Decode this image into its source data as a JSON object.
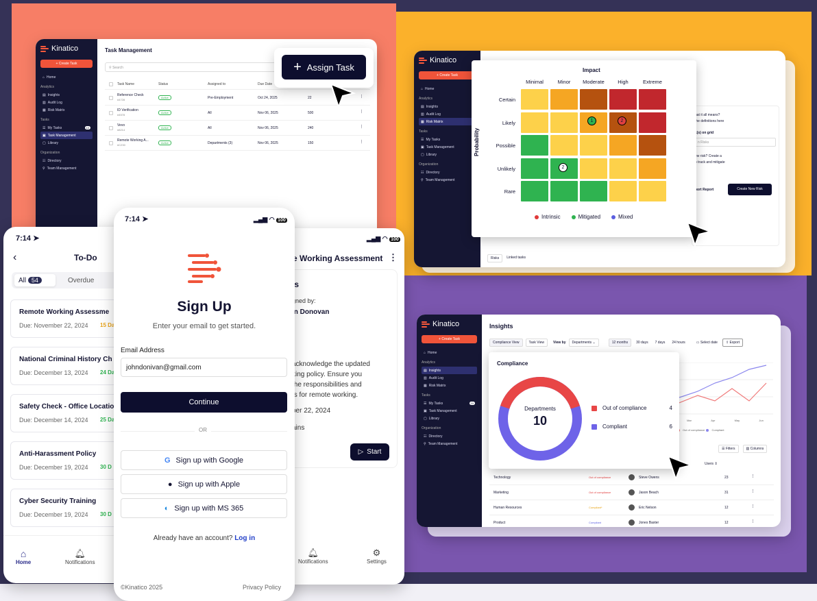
{
  "colors": {
    "coral": "#f77e66",
    "yellow": "#fbb12b",
    "purple": "#7a56ae",
    "navy": "#151633",
    "accent": "#f0543a"
  },
  "brand": "Kinatico",
  "common_nav": {
    "create": "+ Create Task",
    "home": "Home",
    "analytics": "Analytics",
    "insights": "Insights",
    "audit": "Audit Log",
    "risk": "Risk Matrix",
    "tasks": "Tasks",
    "my_tasks": "My Tasks",
    "my_tasks_count": "10",
    "task_mgmt": "Task Management",
    "library": "Library",
    "org": "Organization",
    "directory": "Directory",
    "team": "Team Management"
  },
  "task_panel": {
    "title": "Task Management",
    "search": "Search",
    "assign_btn": "Assign Task",
    "columns": [
      "Task Name",
      "Status",
      "Assigned to",
      "Due Date"
    ],
    "rows": [
      {
        "name": "Reference Check",
        "id": "#4728",
        "status": "Active",
        "assigned": "Pre-Employment",
        "due": "Oct 24, 2025",
        "n": "22"
      },
      {
        "name": "ID Verification",
        "id": "#4578",
        "status": "Active",
        "assigned": "All",
        "due": "Nov 06, 2025",
        "n": "500"
      },
      {
        "name": "Vevo",
        "id": "#8214",
        "status": "Active",
        "assigned": "All",
        "due": "Nov 06, 2025",
        "n": "240"
      },
      {
        "name": "Remote Working A...",
        "id": "#C230",
        "status": "Active",
        "assigned": "Departments (3)",
        "due": "Nov 06, 2025",
        "n": "150"
      }
    ]
  },
  "risk_panel": {
    "impact": "Impact",
    "probability": "Probability",
    "cols": [
      "Minimal",
      "Minor",
      "Moderate",
      "High",
      "Extreme"
    ],
    "rows": [
      "Certain",
      "Likely",
      "Possible",
      "Unlikely",
      "Rare"
    ],
    "legend": [
      {
        "label": "Intrinsic",
        "color": "#e03a3a"
      },
      {
        "label": "Mitigated",
        "color": "#2fb350"
      },
      {
        "label": "Mixed",
        "color": "#5b5fe0"
      }
    ],
    "marker1": "1",
    "marker2": "2",
    "marker3": "2",
    "side_q1": "hat it all means?",
    "side_q2": "the definitions here",
    "side_label": "k(s) on grid",
    "side_select": "n Risks",
    "side_q3": "ew risk? Create a",
    "side_q4": "o track and mitigate",
    "export_report": "port Report",
    "create_risk": "Create New Risk",
    "tab1": "Risks",
    "tab2": "Linked tasks"
  },
  "insights_panel": {
    "title": "Insights",
    "views": [
      "Compliance View",
      "Task View"
    ],
    "view_by": "View by",
    "view_by_val": "Departments",
    "ranges": [
      "12 months",
      "30 days",
      "7 days",
      "24 hours"
    ],
    "select_date": "Select date",
    "export": "Export",
    "compliance": "Compliance",
    "donut_label": "Departments",
    "donut_value": "10",
    "legend": [
      {
        "label": "Out of compliance",
        "value": "4",
        "color": "#e84646"
      },
      {
        "label": "Compliant",
        "value": "6",
        "color": "#6e63e8"
      }
    ],
    "chart_months": [
      "Mar",
      "Apr",
      "May",
      "Jun"
    ],
    "chart_legend": [
      "Out of compliance",
      "Compliant"
    ],
    "filters": "Filters",
    "columns": "Columns",
    "users_col": "Users",
    "rows": [
      {
        "dept": "Technology",
        "status": "Out of compliance",
        "user": "Steve Owens",
        "n": "23"
      },
      {
        "dept": "Marketing",
        "status": "Out of compliance",
        "user": "Jason Beach",
        "n": "31"
      },
      {
        "dept": "Human Resources",
        "status": "Compliant*",
        "user": "Eric Nelson",
        "n": "12"
      },
      {
        "dept": "Product",
        "status": "Compliant",
        "user": "Jones Baxter",
        "n": "12"
      }
    ]
  },
  "phone_todo": {
    "time": "7:14",
    "title": "To-Do",
    "tab_all": "All",
    "tab_all_count": "54",
    "tab_overdue": "Overdue",
    "tab_u": "U",
    "items": [
      {
        "title": "Remote Working Assessme",
        "due": "Due: November 22, 2024",
        "badge": "15 Da",
        "bcolor": "#e8a317"
      },
      {
        "title": "National Criminal History Ch",
        "due": "Due: December 13, 2024",
        "badge": "24 Da",
        "bcolor": "#2fb350"
      },
      {
        "title": "Safety Check - Office Locatio",
        "due": "Due: December 14, 2024",
        "badge": "25 Da",
        "bcolor": "#2fb350"
      },
      {
        "title": "Anti-Harassment Policy",
        "due": "Due: December 19, 2024",
        "badge": "30 D",
        "bcolor": "#2fb350"
      },
      {
        "title": "Cyber Security Training",
        "due": "Due: December 19, 2024",
        "badge": "30 D",
        "bcolor": "#2fb350"
      }
    ],
    "nav_home": "Home",
    "nav_notif": "Notifications"
  },
  "phone_signup": {
    "time": "7:14",
    "battery": "100",
    "title": "Sign Up",
    "subtitle": "Enter your email to get started.",
    "email_label": "Email Address",
    "email_value": "johndonivan@gmail.com",
    "continue": "Continue",
    "or": "OR",
    "google": "Sign up with Google",
    "apple": "Sign up with Apple",
    "ms": "Sign up with MS 365",
    "already": "Already have an account?",
    "login": "Log in",
    "copyright": "©Kinatico 2025",
    "privacy": "Privacy Policy"
  },
  "phone_assess": {
    "battery": "100",
    "title": "e Working Assessment",
    "section": "ls",
    "assigned_by": "gned by:",
    "assigner": "in Donovan",
    "body": [
      "acknowledge the updated",
      "king policy. Ensure you",
      "the responsibilities and",
      "ts for remote working."
    ],
    "date": "ber 22, 2024",
    "remaining": "ains",
    "start": "Start",
    "nav_notif": "Notifications",
    "nav_settings": "Settings"
  }
}
